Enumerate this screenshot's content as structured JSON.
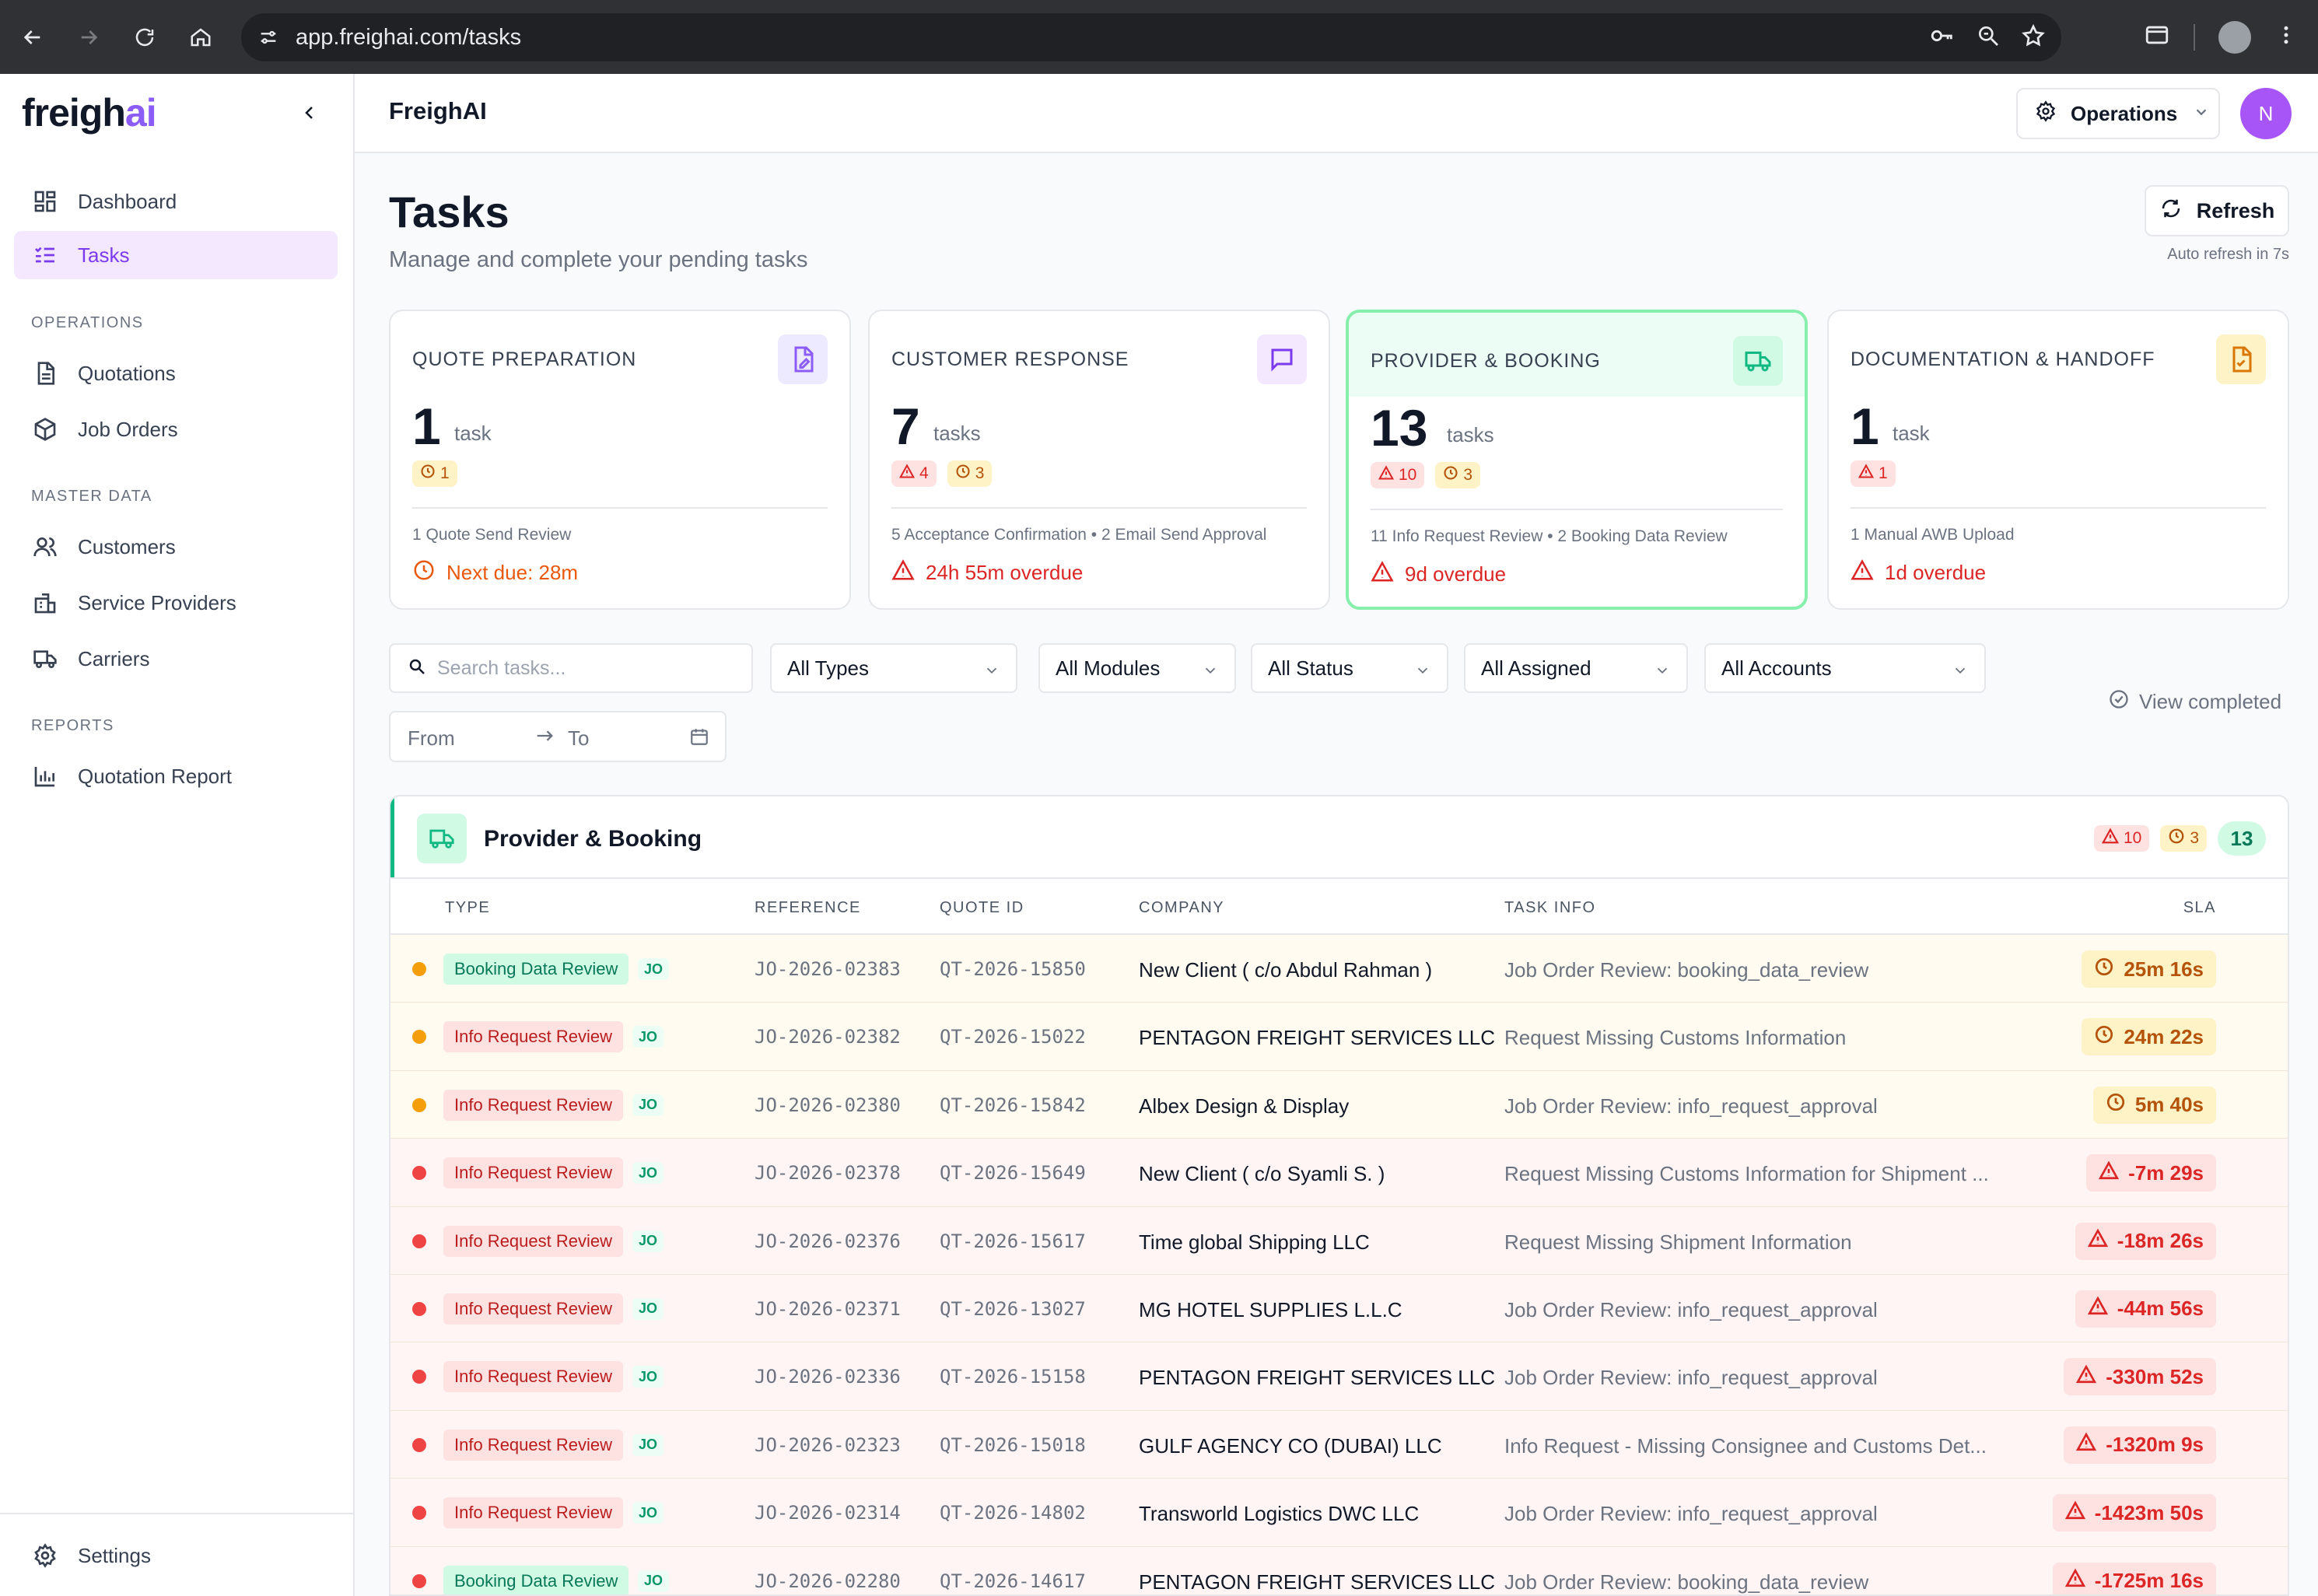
{
  "browser": {
    "url": "app.freighai.com/tasks"
  },
  "sidebar": {
    "logo_main": "freigh",
    "logo_accent": "ai",
    "items": [
      {
        "label": "Dashboard",
        "icon": "dashboard-icon"
      },
      {
        "label": "Tasks",
        "icon": "tasks-icon",
        "active": true
      }
    ],
    "sections": [
      {
        "title": "OPERATIONS",
        "items": [
          {
            "label": "Quotations",
            "icon": "document-icon"
          },
          {
            "label": "Job Orders",
            "icon": "package-icon"
          }
        ]
      },
      {
        "title": "MASTER DATA",
        "items": [
          {
            "label": "Customers",
            "icon": "users-icon"
          },
          {
            "label": "Service Providers",
            "icon": "building-icon"
          },
          {
            "label": "Carriers",
            "icon": "truck-icon"
          }
        ]
      },
      {
        "title": "REPORTS",
        "items": [
          {
            "label": "Quotation Report",
            "icon": "bar-chart-icon"
          }
        ]
      }
    ],
    "settings_label": "Settings"
  },
  "header": {
    "app_title": "FreighAI",
    "role_label": "Operations",
    "avatar_initial": "N"
  },
  "page": {
    "title": "Tasks",
    "subtitle": "Manage and complete your pending tasks",
    "refresh_label": "Refresh",
    "auto_refresh": "Auto refresh in 7s"
  },
  "cards": [
    {
      "name": "QUOTE PREPARATION",
      "count": "1",
      "unit": "task",
      "red": "",
      "amber": "1",
      "summary": "1 Quote Send Review",
      "due": "Next due: 28m",
      "due_kind": "orange",
      "icon_color": "#8b5cf6",
      "icon_bg": "#ede9fe"
    },
    {
      "name": "CUSTOMER RESPONSE",
      "count": "7",
      "unit": "tasks",
      "red": "4",
      "amber": "3",
      "summary": "5 Acceptance Confirmation • 2 Email Send Approval",
      "due": "24h 55m overdue",
      "due_kind": "red",
      "icon_color": "#7c3aed",
      "icon_bg": "#f3e8ff"
    },
    {
      "name": "PROVIDER & BOOKING",
      "count": "13",
      "unit": "tasks",
      "red": "10",
      "amber": "3",
      "summary": "11 Info Request Review • 2 Booking Data Review",
      "due": "9d overdue",
      "due_kind": "red",
      "icon_color": "#10b981",
      "icon_bg": "#d1fae5"
    },
    {
      "name": "DOCUMENTATION & HANDOFF",
      "count": "1",
      "unit": "task",
      "red": "1",
      "amber": "",
      "summary": "1 Manual AWB Upload",
      "due": "1d overdue",
      "due_kind": "red",
      "icon_color": "#d97706",
      "icon_bg": "#fef3c7"
    }
  ],
  "filters": {
    "search_placeholder": "Search tasks...",
    "types": "All Types",
    "modules": "All Modules",
    "status": "All Status",
    "assigned": "All Assigned",
    "accounts": "All Accounts",
    "date_from": "From",
    "date_to": "To",
    "view_completed": "View completed"
  },
  "section": {
    "title": "Provider & Booking",
    "red_count": "10",
    "amber_count": "3",
    "total": "13",
    "columns": [
      "TYPE",
      "REFERENCE",
      "QUOTE ID",
      "COMPANY",
      "TASK INFO",
      "SLA"
    ]
  },
  "rows": [
    {
      "status": "warn",
      "type": "Booking Data Review",
      "type_color": "green",
      "module": "JO",
      "ref": "JO-2026-02383",
      "quote": "QT-2026-15850",
      "company": "New Client ( c/o Abdul Rahman )",
      "info": "Job Order Review: booking_data_review",
      "sla": "25m 16s"
    },
    {
      "status": "warn",
      "type": "Info Request Review",
      "type_color": "red",
      "module": "JO",
      "ref": "JO-2026-02382",
      "quote": "QT-2026-15022",
      "company": "PENTAGON FREIGHT SERVICES LLC",
      "info": "Request Missing Customs Information",
      "sla": "24m 22s"
    },
    {
      "status": "warn",
      "type": "Info Request Review",
      "type_color": "red",
      "module": "JO",
      "ref": "JO-2026-02380",
      "quote": "QT-2026-15842",
      "company": "Albex Design & Display",
      "info": "Job Order Review: info_request_approval",
      "sla": "5m 40s"
    },
    {
      "status": "over",
      "type": "Info Request Review",
      "type_color": "red",
      "module": "JO",
      "ref": "JO-2026-02378",
      "quote": "QT-2026-15649",
      "company": "New Client ( c/o Syamli S. )",
      "info": "Request Missing Customs Information for Shipment ...",
      "sla": "-7m 29s"
    },
    {
      "status": "over",
      "type": "Info Request Review",
      "type_color": "red",
      "module": "JO",
      "ref": "JO-2026-02376",
      "quote": "QT-2026-15617",
      "company": "Time global Shipping LLC",
      "info": "Request Missing Shipment Information",
      "sla": "-18m 26s"
    },
    {
      "status": "over",
      "type": "Info Request Review",
      "type_color": "red",
      "module": "JO",
      "ref": "JO-2026-02371",
      "quote": "QT-2026-13027",
      "company": "MG HOTEL SUPPLIES L.L.C",
      "info": "Job Order Review: info_request_approval",
      "sla": "-44m 56s"
    },
    {
      "status": "over",
      "type": "Info Request Review",
      "type_color": "red",
      "module": "JO",
      "ref": "JO-2026-02336",
      "quote": "QT-2026-15158",
      "company": "PENTAGON FREIGHT SERVICES LLC",
      "info": "Job Order Review: info_request_approval",
      "sla": "-330m 52s"
    },
    {
      "status": "over",
      "type": "Info Request Review",
      "type_color": "red",
      "module": "JO",
      "ref": "JO-2026-02323",
      "quote": "QT-2026-15018",
      "company": "GULF AGENCY CO (DUBAI) LLC",
      "info": "Info Request - Missing Consignee and Customs Det...",
      "sla": "-1320m 9s"
    },
    {
      "status": "over",
      "type": "Info Request Review",
      "type_color": "red",
      "module": "JO",
      "ref": "JO-2026-02314",
      "quote": "QT-2026-14802",
      "company": "Transworld Logistics DWC LLC",
      "info": "Job Order Review: info_request_approval",
      "sla": "-1423m 50s"
    },
    {
      "status": "over",
      "type": "Booking Data Review",
      "type_color": "green",
      "module": "JO",
      "ref": "JO-2026-02280",
      "quote": "QT-2026-14617",
      "company": "PENTAGON FREIGHT SERVICES LLC",
      "info": "Job Order Review: booking_data_review",
      "sla": "-1725m 16s"
    }
  ]
}
